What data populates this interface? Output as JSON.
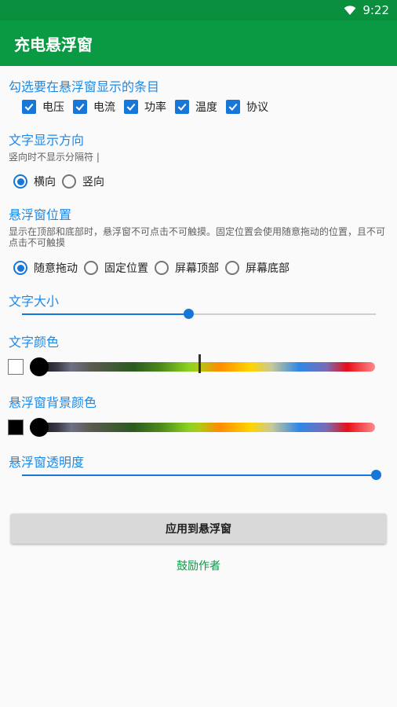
{
  "status_bar": {
    "time": "9:22",
    "wifi_icon": "wifi-icon"
  },
  "app_bar": {
    "title": "充电悬浮窗"
  },
  "display_items": {
    "title": "勾选要在悬浮窗显示的条目",
    "items": [
      {
        "label": "电压",
        "checked": true
      },
      {
        "label": "电流",
        "checked": true
      },
      {
        "label": "功率",
        "checked": true
      },
      {
        "label": "温度",
        "checked": true
      },
      {
        "label": "协议",
        "checked": true
      }
    ]
  },
  "text_direction": {
    "title": "文字显示方向",
    "hint": "竖向时不显示分隔符 |",
    "options": [
      {
        "label": "横向",
        "selected": true
      },
      {
        "label": "竖向",
        "selected": false
      }
    ]
  },
  "window_position": {
    "title": "悬浮窗位置",
    "hint": "显示在顶部和底部时，悬浮窗不可点击不可触摸。固定位置会使用随意拖动的位置，且不可点击不可触摸",
    "options": [
      {
        "label": "随意拖动",
        "selected": true
      },
      {
        "label": "固定位置",
        "selected": false
      },
      {
        "label": "屏幕顶部",
        "selected": false
      },
      {
        "label": "屏幕底部",
        "selected": false
      }
    ]
  },
  "text_size": {
    "title": "文字大小",
    "value_fraction": 0.47
  },
  "text_color": {
    "title": "文字颜色",
    "swatch_color": "#ffffff",
    "hue_fraction": 0.0,
    "marker_fraction": 0.49
  },
  "bg_color": {
    "title": "悬浮窗背景颜色",
    "swatch_color": "#000000",
    "hue_fraction": 0.0
  },
  "opacity": {
    "title": "悬浮窗透明度",
    "value_fraction": 1.0
  },
  "actions": {
    "apply_label": "应用到悬浮窗",
    "encourage_label": "鼓励作者"
  },
  "colors": {
    "accent": "#1677d8",
    "primary": "#0b9a44",
    "primary_dark": "#0a8f3e"
  }
}
